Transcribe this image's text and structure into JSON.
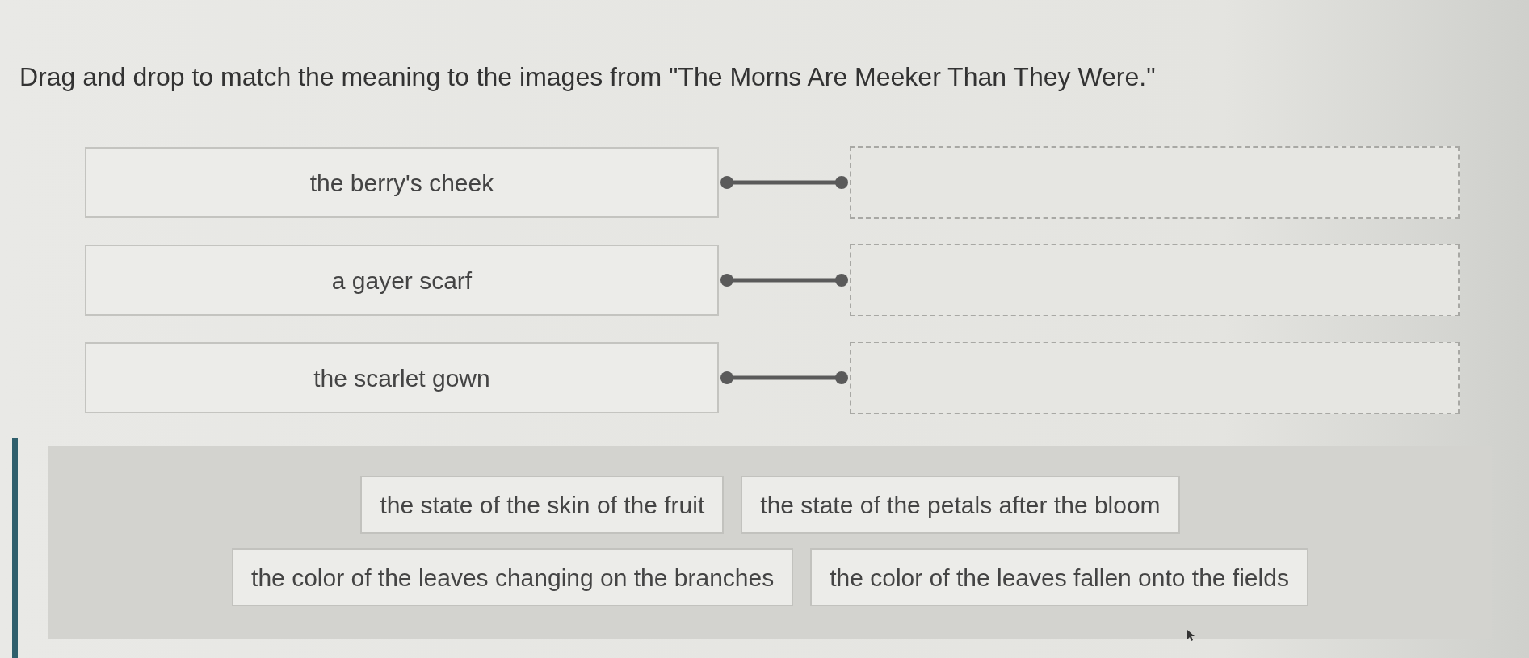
{
  "instruction": "Drag and drop to match the meaning to the images from \"The Morns Are Meeker Than They Were.\"",
  "pairs": [
    {
      "prompt": "the berry's cheek"
    },
    {
      "prompt": "a gayer scarf"
    },
    {
      "prompt": "the scarlet gown"
    }
  ],
  "answer_bank": {
    "rows": [
      {
        "answers": [
          "the state of the skin of the fruit",
          "the state of the petals after the bloom"
        ]
      },
      {
        "answers": [
          "the color of the leaves changing on the branches",
          "the color of the leaves fallen onto the fields"
        ]
      }
    ]
  }
}
